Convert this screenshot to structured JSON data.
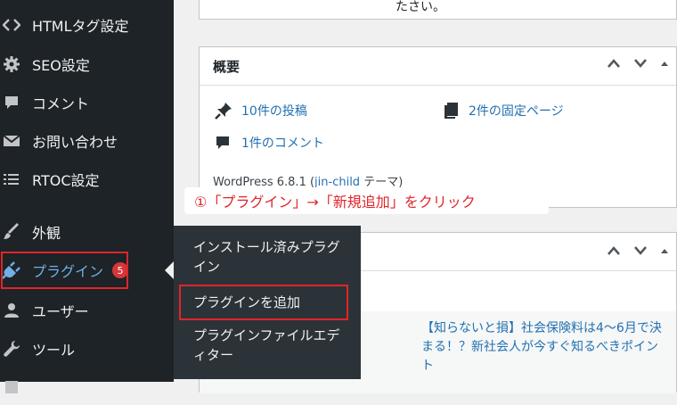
{
  "sidebar": {
    "items": [
      {
        "label": "HTMLタグ設定",
        "icon": "code-icon"
      },
      {
        "label": "SEO設定",
        "icon": "gear-icon"
      },
      {
        "label": "コメント",
        "icon": "comment-icon"
      },
      {
        "label": "お問い合わせ",
        "icon": "mail-icon"
      },
      {
        "label": "RTOC設定",
        "icon": "list-icon"
      },
      {
        "label": "外観",
        "icon": "brush-icon"
      },
      {
        "label": "プラグイン",
        "icon": "plugin-icon",
        "badge": "5"
      },
      {
        "label": "ユーザー",
        "icon": "user-icon"
      },
      {
        "label": "ツール",
        "icon": "wrench-icon"
      }
    ]
  },
  "flyout": {
    "items": [
      {
        "label": "インストール済みプラグイン"
      },
      {
        "label": "プラグインを追加"
      },
      {
        "label": "プラグインファイルエディター"
      }
    ]
  },
  "top_panel": {
    "text": "たさい。"
  },
  "overview": {
    "title": "概要",
    "posts": "10件の投稿",
    "pages": "2件の固定ページ",
    "comments": "1件のコメント",
    "version_prefix": "WordPress 6.8.1 (",
    "theme_link": "jin-child",
    "version_suffix": " テーマ)"
  },
  "news": {
    "headline": "【知らないと損】社会保険料は4〜6月で決まる！？新社会人が今すぐ知るべきポイント"
  },
  "annotation": {
    "text": "①「プラグイン」→「新規追加」をクリック"
  },
  "colors": {
    "highlight": "#e0252b",
    "link": "#2271b1",
    "sidebar": "#1d2327"
  }
}
